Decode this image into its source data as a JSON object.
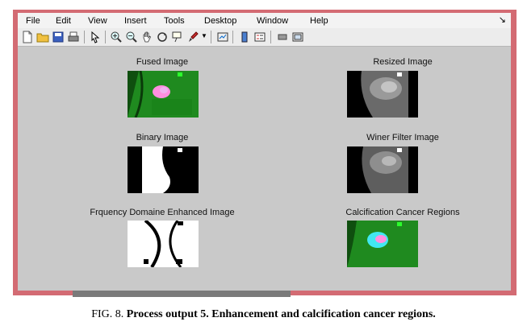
{
  "menu": [
    "File",
    "Edit",
    "View",
    "Insert",
    "Tools",
    "Desktop",
    "Window",
    "Help"
  ],
  "toolbar_icons": [
    "new-file-icon",
    "open-folder-icon",
    "save-icon",
    "print-icon",
    "pointer-icon",
    "zoom-in-icon",
    "zoom-out-icon",
    "pan-hand-icon",
    "rotate-icon",
    "data-cursor-icon",
    "brush-icon",
    "dropdown-arrow-icon",
    "link-plot-icon",
    "colorbar-icon",
    "legend-icon",
    "hide-plot-tools-icon",
    "show-plot-tools-icon"
  ],
  "panels": {
    "fused": {
      "title": "Fused Image"
    },
    "resized": {
      "title": "Resized Image"
    },
    "binary": {
      "title": "Binary Image"
    },
    "winer": {
      "title": "Winer Filter Image"
    },
    "frequency": {
      "title": "Frquency Domaine Enhanced Image"
    },
    "calcification": {
      "title": "Calcification Cancer Regions"
    }
  },
  "caption": {
    "prefix": "FIG. 8.",
    "text": "Process output 5. Enhancement and calcification cancer regions."
  },
  "colors": {
    "frame": "#d36b73",
    "figure_bg": "#c9c9c9",
    "green": "#1f8a1f",
    "pink": "#ff8fe0",
    "cyan": "#41e8f0"
  }
}
